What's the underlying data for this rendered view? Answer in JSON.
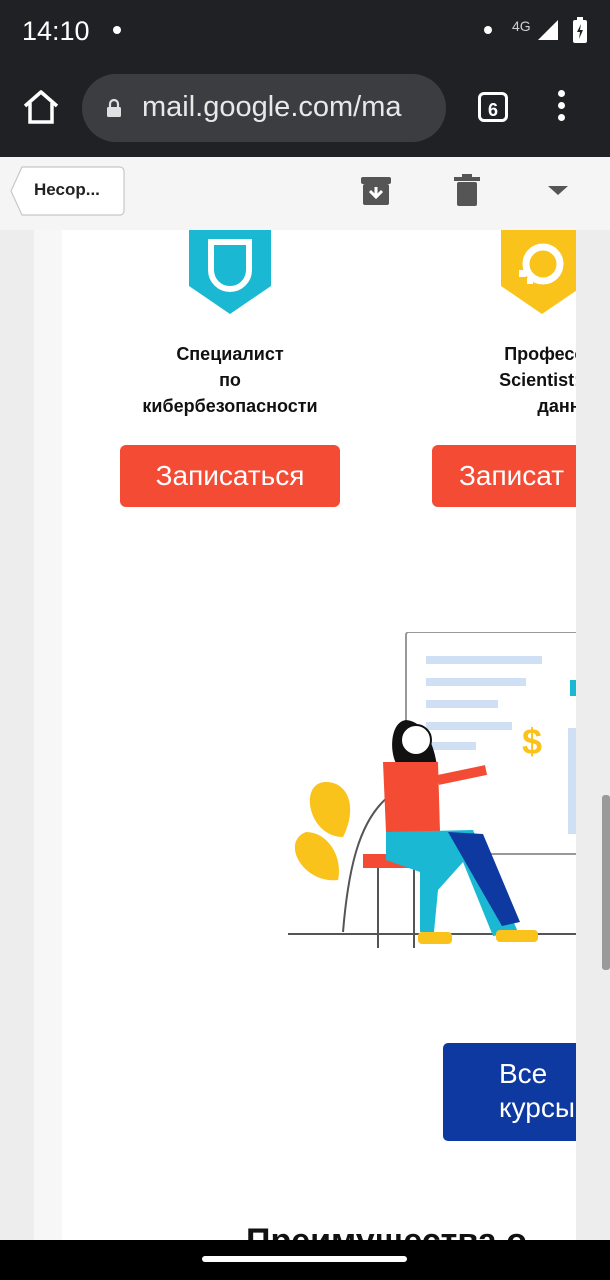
{
  "status": {
    "time": "14:10",
    "network": "4G"
  },
  "browser": {
    "url": "mail.google.com/ma",
    "tab_count": "6"
  },
  "toolbar": {
    "back_label": "Несор..."
  },
  "courses": [
    {
      "title": "Специалист\nпо кибербезопасности",
      "button": "Записаться",
      "badge_color": "#1bb8d3"
    },
    {
      "title": "Профессия\nScientist: ан\nданных",
      "button": "Записат",
      "badge_color": "#f9c31b"
    }
  ],
  "all_courses": {
    "label": "Все\nкурсы"
  },
  "section_heading": "Преимущества о",
  "colors": {
    "accent_red": "#f44b34",
    "accent_blue": "#0e39a1"
  }
}
